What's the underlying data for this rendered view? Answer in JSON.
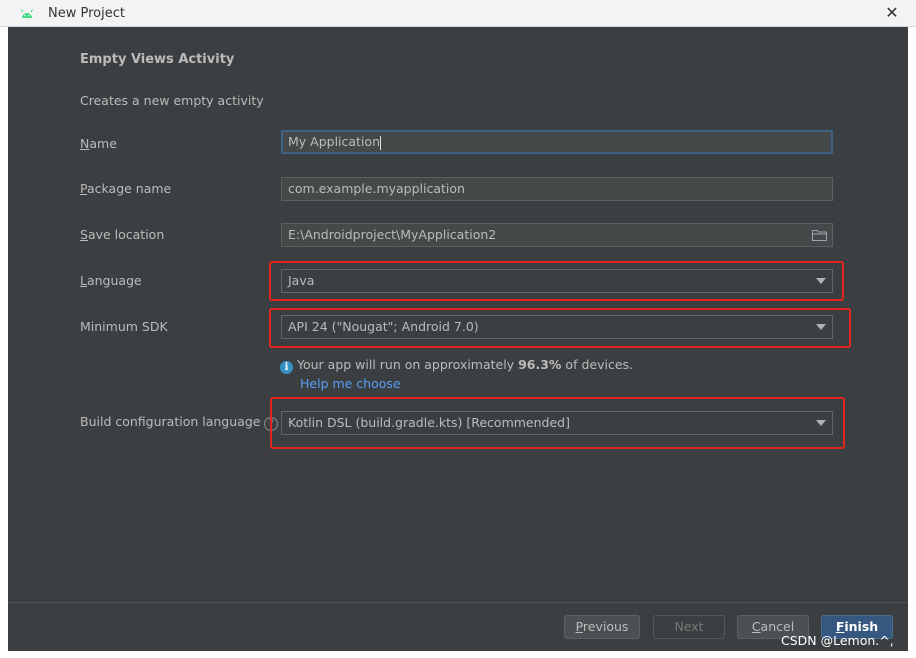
{
  "window": {
    "title": "New Project",
    "close_glyph": "✕",
    "app_icon": "android-icon"
  },
  "page": {
    "heading": "Empty Views Activity",
    "description": "Creates a new empty activity"
  },
  "form": {
    "name": {
      "label_mnemonic": "N",
      "label_rest": "ame",
      "value": "My Application"
    },
    "package_name": {
      "label_mnemonic": "P",
      "label_rest": "ackage name",
      "value": "com.example.myapplication"
    },
    "save_location": {
      "label_mnemonic": "S",
      "label_rest": "ave location",
      "value": "E:\\Androidproject\\MyApplication2",
      "icon": "folder-icon"
    },
    "language": {
      "label_mnemonic": "L",
      "label_rest": "anguage",
      "value": "Java"
    },
    "minimum_sdk": {
      "label": "Minimum SDK",
      "value": "API 24 (\"Nougat\"; Android 7.0)"
    },
    "build_config_language": {
      "label": "Build configuration language",
      "value": "Kotlin DSL (build.gradle.kts) [Recommended]",
      "help_glyph": "?"
    }
  },
  "info": {
    "icon_glyph": "i",
    "text_before": "Your app will run on approximately ",
    "percent": "96.3%",
    "text_after": " of devices.",
    "link": "Help me choose"
  },
  "buttons": {
    "previous": {
      "mnemonic": "P",
      "rest": "revious"
    },
    "next": {
      "label": "Next"
    },
    "cancel": {
      "mnemonic": "C",
      "rest": "ancel"
    },
    "finish": {
      "mnemonic": "F",
      "rest": "inish"
    }
  },
  "watermark": "CSDN @Lemon.^,",
  "colors": {
    "background": "#3c3f41",
    "field": "#45494a",
    "accent": "#365880",
    "link": "#589df6",
    "highlight": "#e0261f",
    "info": "#3592c4"
  }
}
